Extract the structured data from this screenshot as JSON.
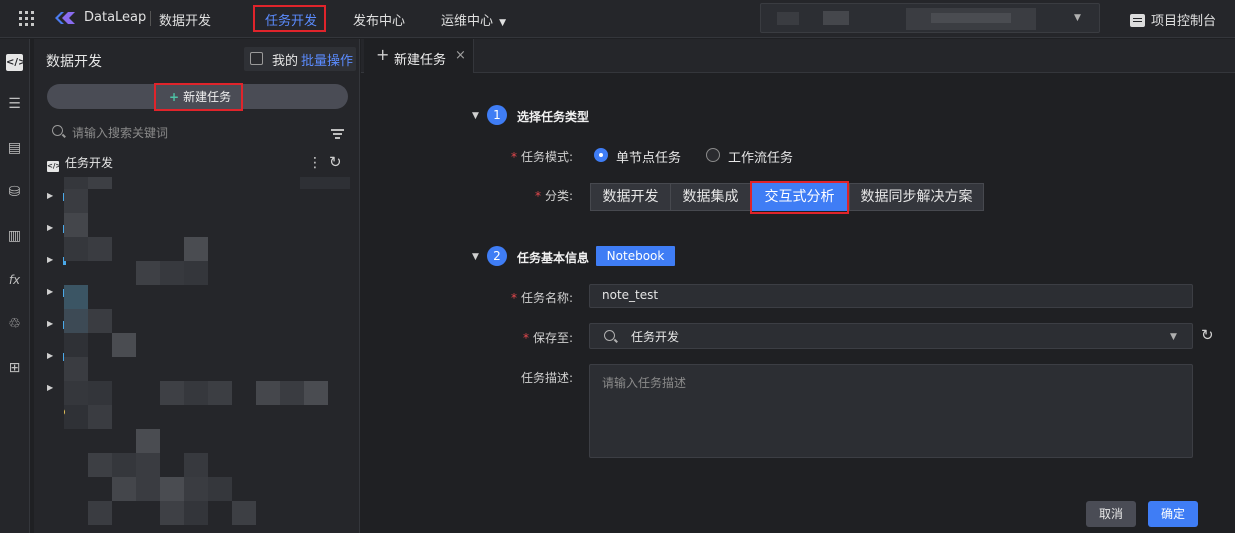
{
  "topbar": {
    "brand": "DataLeap",
    "brand_sub": "数据开发",
    "nav": [
      {
        "label": "任务开发",
        "active": true
      },
      {
        "label": "发布中心",
        "active": false
      },
      {
        "label": "运维中心",
        "active": false
      }
    ],
    "nav_dropdown_caret": "▼",
    "console_label": "项目控制台"
  },
  "sidebar": {
    "title": "数据开发",
    "mine_label": "我的",
    "batch_label": "批量操作",
    "new_task_label": "新建任务",
    "search_placeholder": "请输入搜索关键词",
    "tree_root_label": "任务开发"
  },
  "tabs": [
    {
      "label": "新建任务"
    }
  ],
  "form": {
    "step1": {
      "number": "1",
      "title": "选择任务类型"
    },
    "mode_label": "任务模式:",
    "modes": [
      {
        "label": "单节点任务",
        "selected": true
      },
      {
        "label": "工作流任务",
        "selected": false
      }
    ],
    "category_label": "分类:",
    "categories": [
      {
        "label": "数据开发",
        "selected": false
      },
      {
        "label": "数据集成",
        "selected": false
      },
      {
        "label": "交互式分析",
        "selected": true
      },
      {
        "label": "数据同步解决方案",
        "selected": false
      }
    ],
    "step2": {
      "number": "2",
      "title": "任务基本信息",
      "badge": "Notebook"
    },
    "name_label": "任务名称:",
    "name_value": "note_test",
    "save_label": "保存至:",
    "save_value": "任务开发",
    "desc_label": "任务描述:",
    "desc_placeholder": "请输入任务描述",
    "cancel_label": "取消",
    "ok_label": "确定"
  },
  "colors": {
    "accent": "#3f7df5",
    "highlight_box": "#e0242b",
    "background": "#1f2023"
  }
}
